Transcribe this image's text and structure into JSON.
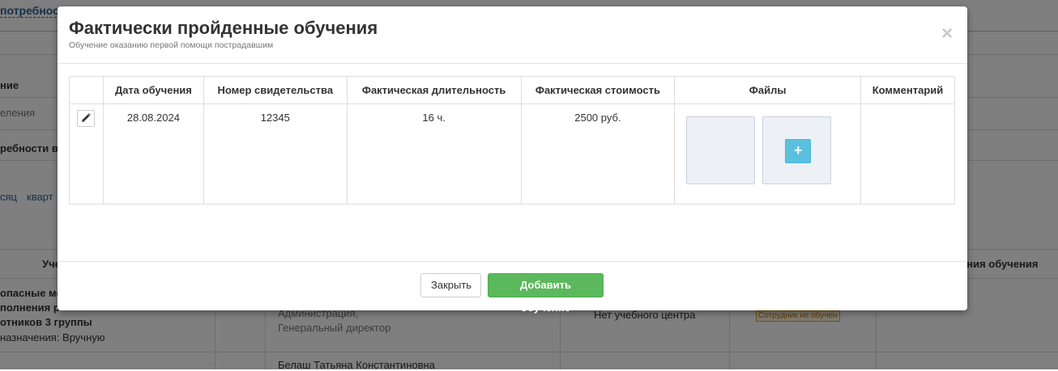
{
  "background": {
    "top_left_link": "потребност",
    "row_labels": [
      "ние",
      "еления",
      "ребности в с",
      "сяц",
      "кварт"
    ],
    "col_header_left": "Уче",
    "col_header_right": "ания обучения",
    "row1": {
      "line1": "опасные ме",
      "line2": "полнения р",
      "line3": "отников 3 группы",
      "line4": "назначения: Вручную",
      "person_department": "Администрация,",
      "person_position": "Генеральный директор",
      "center": "Нет учебного центра",
      "status_badge": "Сотрудник не обучен"
    },
    "row2": {
      "person_name": "Белаш Татьяна Константиновна"
    }
  },
  "modal": {
    "title": "Фактически пройденные обучения",
    "subtitle": "Обучение оказанию первой помощи пострадавшим",
    "close_symbol": "×",
    "table": {
      "headers": [
        "",
        "Дата обучения",
        "Номер свидетельства",
        "Фактическая длительность",
        "Фактическая стоимость",
        "Файлы",
        "Комментарий"
      ],
      "rows": [
        {
          "date": "28.08.2024",
          "certificate": "12345",
          "duration": "16 ч.",
          "cost": "2500 руб.",
          "comment": ""
        }
      ]
    },
    "add_file_symbol": "+",
    "buttons": {
      "close": "Закрыть",
      "add": "Добавить обучение"
    }
  },
  "colors": {
    "primary_success": "#5cb85c",
    "info": "#5bc0de",
    "link": "#2a6496"
  }
}
